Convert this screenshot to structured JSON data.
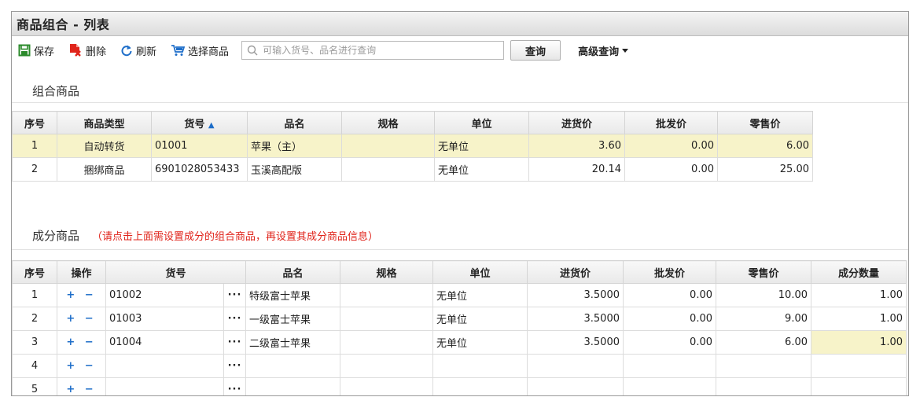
{
  "window": {
    "title": "商品组合 - 列表"
  },
  "toolbar": {
    "save_label": "保存",
    "delete_label": "删除",
    "refresh_label": "刷新",
    "select_label": "选择商品",
    "search_placeholder": "可输入货号、品名进行查询",
    "query_label": "查询",
    "advanced_label": "高级查询"
  },
  "combo": {
    "title": "组合商品",
    "columns": [
      "序号",
      "商品类型",
      "货号",
      "品名",
      "规格",
      "单位",
      "进货价",
      "批发价",
      "零售价"
    ],
    "sort_indicator": "▲",
    "rows": [
      {
        "no": "1",
        "type": "自动转货",
        "code": "01001",
        "name": "苹果（主）",
        "spec": "",
        "unit": "无单位",
        "buy": "3.60",
        "wholesale": "0.00",
        "retail": "6.00"
      },
      {
        "no": "2",
        "type": "捆绑商品",
        "code": "6901028053433",
        "name": "玉溪高配版",
        "spec": "",
        "unit": "无单位",
        "buy": "20.14",
        "wholesale": "0.00",
        "retail": "25.00"
      }
    ]
  },
  "component": {
    "title": "成分商品",
    "note": "（请点击上面需设置成分的组合商品，再设置其成分商品信息）",
    "columns": [
      "序号",
      "操作",
      "货号",
      "品名",
      "规格",
      "单位",
      "进货价",
      "批发价",
      "零售价",
      "成分数量"
    ],
    "ops": "+ −",
    "dots": "···",
    "rows": [
      {
        "no": "1",
        "code": "01002",
        "name": "特级富士苹果",
        "spec": "",
        "unit": "无单位",
        "buy": "3.5000",
        "wholesale": "0.00",
        "retail": "10.00",
        "qty": "1.00"
      },
      {
        "no": "2",
        "code": "01003",
        "name": "一级富士苹果",
        "spec": "",
        "unit": "无单位",
        "buy": "3.5000",
        "wholesale": "0.00",
        "retail": "9.00",
        "qty": "1.00"
      },
      {
        "no": "3",
        "code": "01004",
        "name": "二级富士苹果",
        "spec": "",
        "unit": "无单位",
        "buy": "3.5000",
        "wholesale": "0.00",
        "retail": "6.00",
        "qty": "1.00"
      },
      {
        "no": "4",
        "code": "",
        "name": "",
        "spec": "",
        "unit": "",
        "buy": "",
        "wholesale": "",
        "retail": "",
        "qty": ""
      },
      {
        "no": "5",
        "code": "",
        "name": "",
        "spec": "",
        "unit": "",
        "buy": "",
        "wholesale": "",
        "retail": "",
        "qty": ""
      }
    ]
  },
  "colors": {
    "accent": "#1e6ec9",
    "highlight": "#f7f3c9",
    "note": "#e0241b",
    "save_icon": "#2a8a2a",
    "delete_icon": "#e0241b"
  }
}
